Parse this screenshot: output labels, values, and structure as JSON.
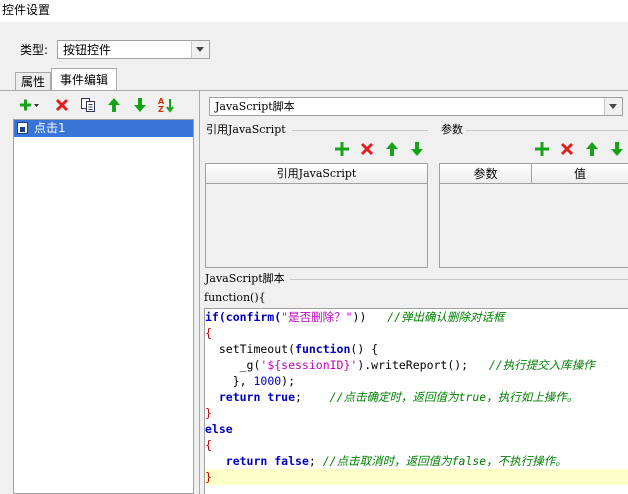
{
  "window": {
    "title": "控件设置"
  },
  "type_row": {
    "label": "类型:",
    "value": "按钮控件"
  },
  "tabs": [
    {
      "label": "属性",
      "active": false
    },
    {
      "label": "事件编辑",
      "active": true
    }
  ],
  "left_toolbar": {
    "icons": [
      "add-dropdown-icon",
      "delete-icon",
      "copy-icon",
      "move-up-icon",
      "move-down-icon",
      "sort-az-icon"
    ]
  },
  "event_list": {
    "items": [
      {
        "label": "点击1",
        "selected": true
      }
    ]
  },
  "script_type": {
    "value": "JavaScript脚本"
  },
  "ref_group": {
    "title": "引用JavaScript",
    "column_header": "引用JavaScript",
    "icons": [
      "add-icon",
      "delete-icon",
      "move-up-icon",
      "move-down-icon"
    ]
  },
  "param_group": {
    "title": "参数",
    "columns": [
      "参数",
      "值"
    ],
    "icons": [
      "add-icon",
      "delete-icon",
      "move-up-icon",
      "move-down-icon"
    ]
  },
  "script_group": {
    "title": "JavaScript脚本",
    "function_header": "function(){"
  },
  "code": {
    "lines": [
      [
        {
          "t": "if(confirm(",
          "c": "kw"
        },
        {
          "t": "\"是否删除？\"",
          "c": "str"
        },
        {
          "t": "))",
          "c": ""
        },
        {
          "t": "   //弹出确认删除对话框",
          "c": "cmt"
        }
      ],
      [
        {
          "t": "{",
          "c": "brc"
        }
      ],
      [
        {
          "t": "  setTimeout(",
          "c": ""
        },
        {
          "t": "function",
          "c": "kw"
        },
        {
          "t": "() {",
          "c": ""
        }
      ],
      [
        {
          "t": "     _g(",
          "c": ""
        },
        {
          "t": "'${sessionID}'",
          "c": "str"
        },
        {
          "t": ").writeReport();",
          "c": ""
        },
        {
          "t": "   //执行提交入库操作",
          "c": "cmt"
        }
      ],
      [
        {
          "t": "    }, ",
          "c": ""
        },
        {
          "t": "1000",
          "c": "num"
        },
        {
          "t": ");",
          "c": ""
        }
      ],
      [
        {
          "t": "  ",
          "c": ""
        },
        {
          "t": "return true",
          "c": "kw"
        },
        {
          "t": ";",
          "c": ""
        },
        {
          "t": "    //点击确定时，返回值为true，执行如上操作。",
          "c": "cmt"
        }
      ],
      [
        {
          "t": "}",
          "c": "brc"
        }
      ],
      [
        {
          "t": "else",
          "c": "kw"
        }
      ],
      [
        {
          "t": "{",
          "c": "brc"
        }
      ],
      [
        {
          "t": "   ",
          "c": ""
        },
        {
          "t": "return false",
          "c": "kw"
        },
        {
          "t": "; ",
          "c": ""
        },
        {
          "t": "//点击取消时，返回值为false，不执行操作。",
          "c": "cmt"
        }
      ],
      [
        {
          "t": "}",
          "c": "brc"
        }
      ]
    ],
    "current_line_index": 10
  },
  "colors": {
    "selection": "#3875d7",
    "add_green": "#17a317",
    "delete_red": "#e02020",
    "keyword": "#0000c0",
    "string": "#c000c0",
    "comment": "#008000",
    "current_line": "#ffffc8"
  }
}
